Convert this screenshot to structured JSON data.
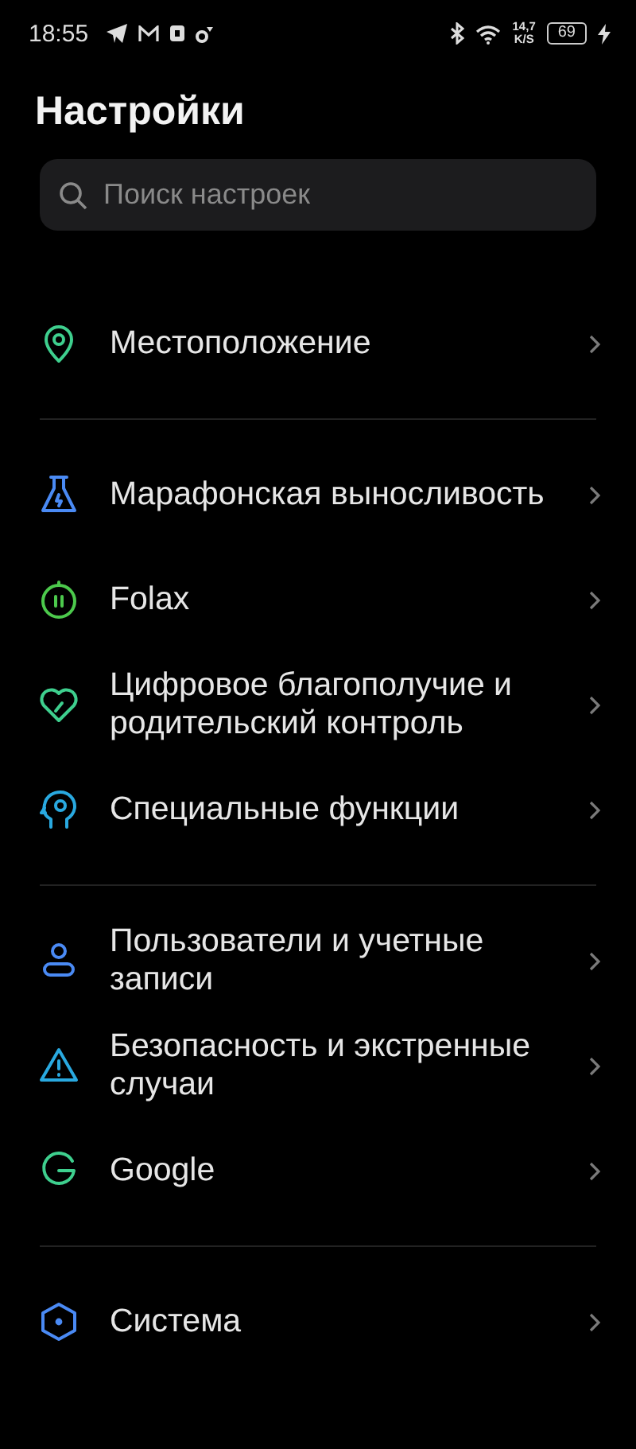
{
  "status_bar": {
    "time": "18:55",
    "speed": "14,7",
    "speed_unit": "K/S",
    "battery": "69"
  },
  "title": "Настройки",
  "search": {
    "placeholder": "Поиск настроек"
  },
  "groups": [
    {
      "items": [
        {
          "label": "Местоположение",
          "kind": "pin",
          "color": "#3ecf8e"
        }
      ]
    },
    {
      "items": [
        {
          "label": "Марафонская выносливость",
          "kind": "flask",
          "color": "#4a8af4"
        },
        {
          "label": "Folax",
          "kind": "timer",
          "color": "#4cc94c"
        },
        {
          "label": "Цифровое благополучие и родительский контроль",
          "kind": "heart",
          "color": "#3ecf8e"
        },
        {
          "label": "Специальные функции",
          "kind": "head",
          "color": "#29a9e0"
        }
      ]
    },
    {
      "items": [
        {
          "label": "Пользователи и учетные записи",
          "kind": "user",
          "color": "#4a8af4"
        },
        {
          "label": "Безопасность и экстренные случаи",
          "kind": "warning",
          "color": "#29a9e0"
        },
        {
          "label": "Google",
          "kind": "g",
          "color": "#3ecf8e"
        }
      ]
    },
    {
      "items": [
        {
          "label": "Система",
          "kind": "hex",
          "color": "#4a8af4"
        }
      ]
    }
  ]
}
